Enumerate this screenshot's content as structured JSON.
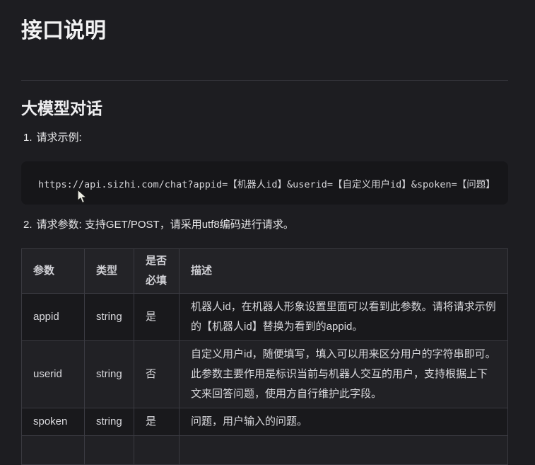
{
  "page": {
    "title": "接口说明",
    "section_title": "大模型对话"
  },
  "steps": [
    {
      "number": "1.",
      "text": "请求示例:"
    },
    {
      "number": "2.",
      "text": "请求参数: 支持GET/POST，请采用utf8编码进行请求。"
    }
  ],
  "code_block": {
    "content": "https://api.sizhi.com/chat?appid=【机器人id】&userid=【自定义用户id】&spoken=【问题】"
  },
  "params_table": {
    "headers": [
      "参数",
      "类型",
      "是否必填",
      "描述"
    ],
    "rows": [
      {
        "param": "appid",
        "type": "string",
        "required": "是",
        "description": "机器人id，在机器人形象设置里面可以看到此参数。请将请求示例的【机器人id】替换为看到的appid。"
      },
      {
        "param": "userid",
        "type": "string",
        "required": "否",
        "description": "自定义用户id，随便填写，填入可以用来区分用户的字符串即可。此参数主要作用是标识当前与机器人交互的用户，支持根据上下文来回答问题，使用方自行维护此字段。"
      },
      {
        "param": "spoken",
        "type": "string",
        "required": "是",
        "description": "问题，用户输入的问题。"
      }
    ]
  },
  "colors": {
    "page_background": "#1d1d21",
    "code_block_background": "#161619",
    "table_header_background": "#232327",
    "table_row_dark": "#19191c",
    "table_row_light": "#212125",
    "border": "#3a3a41",
    "heading_text": "#f2f2f3",
    "body_text": "#d9d9dd"
  }
}
